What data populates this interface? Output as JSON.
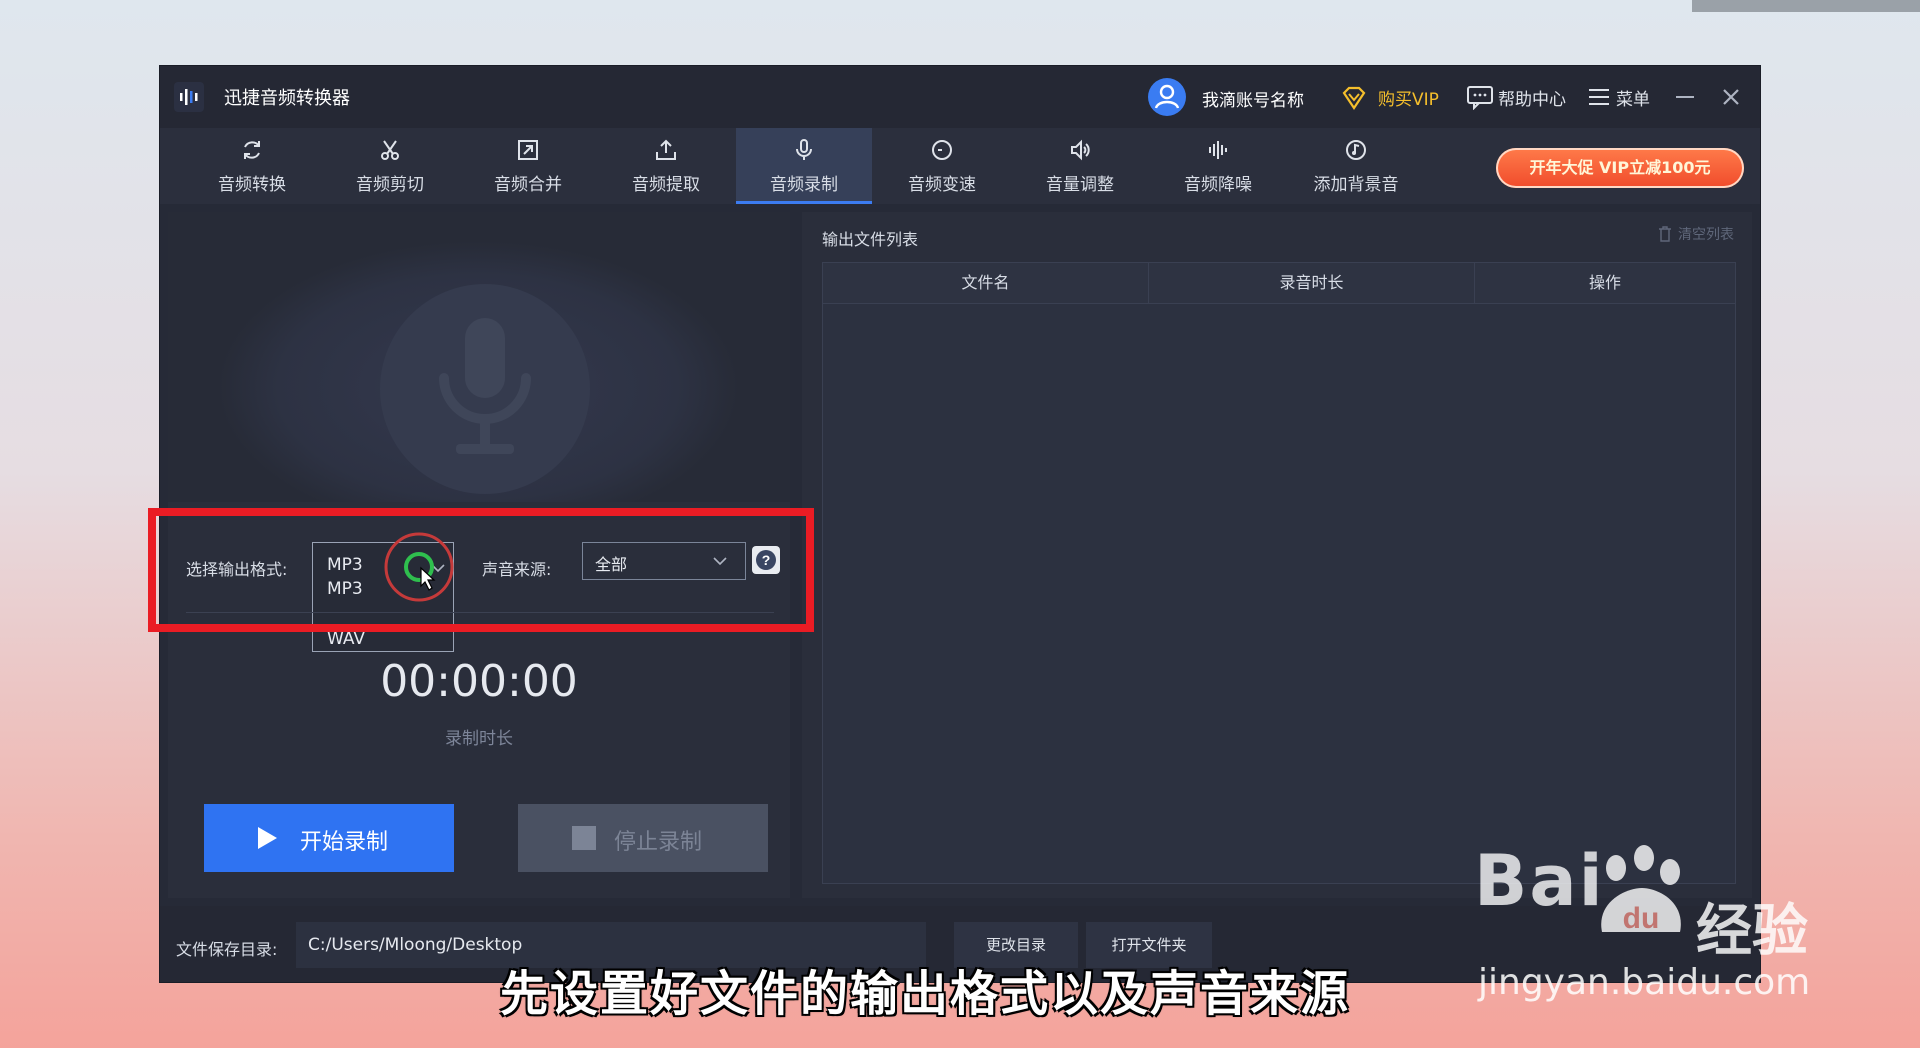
{
  "app": {
    "title": "迅捷音频转换器",
    "account_name": "我滴账号名称",
    "buy_vip": "购买VIP",
    "help_center": "帮助中心",
    "menu": "菜单"
  },
  "toolbar": {
    "items": [
      {
        "label": "音频转换",
        "icon": "refresh-icon"
      },
      {
        "label": "音频剪切",
        "icon": "scissors-icon"
      },
      {
        "label": "音频合并",
        "icon": "merge-icon"
      },
      {
        "label": "音频提取",
        "icon": "upload-icon"
      },
      {
        "label": "音频录制",
        "icon": "microphone-icon",
        "active": true
      },
      {
        "label": "音频变速",
        "icon": "speed-icon"
      },
      {
        "label": "音量调整",
        "icon": "volume-icon"
      },
      {
        "label": "音频降噪",
        "icon": "waveform-icon"
      },
      {
        "label": "添加背景音",
        "icon": "music-note-icon"
      }
    ],
    "promo": "开年大促 VIP立减100元"
  },
  "recorder": {
    "format_label": "选择输出格式:",
    "format_value": "MP3",
    "format_options": [
      "MP3",
      "WAV"
    ],
    "source_label": "声音来源:",
    "source_value": "全部",
    "timer": "00:00:00",
    "timer_label": "录制时长",
    "start_button": "开始录制",
    "stop_button": "停止录制"
  },
  "output_list": {
    "title": "输出文件列表",
    "clear": "清空列表",
    "columns": [
      "文件名",
      "录音时长",
      "操作"
    ],
    "rows": []
  },
  "save": {
    "label": "文件保存目录:",
    "path": "C:/Users/Mloong/Desktop",
    "change_dir": "更改目录",
    "open_folder": "打开文件夹"
  },
  "overlay": {
    "subtitle": "先设置好文件的输出格式以及声音来源",
    "watermark_brand": "Bai",
    "watermark_brand_paw": "du",
    "watermark_cn": "经验",
    "watermark_url": "jingyan.baidu.com"
  },
  "colors": {
    "accent": "#2f73f2",
    "vip": "#f5bf2c",
    "highlight": "#ea1c24"
  }
}
